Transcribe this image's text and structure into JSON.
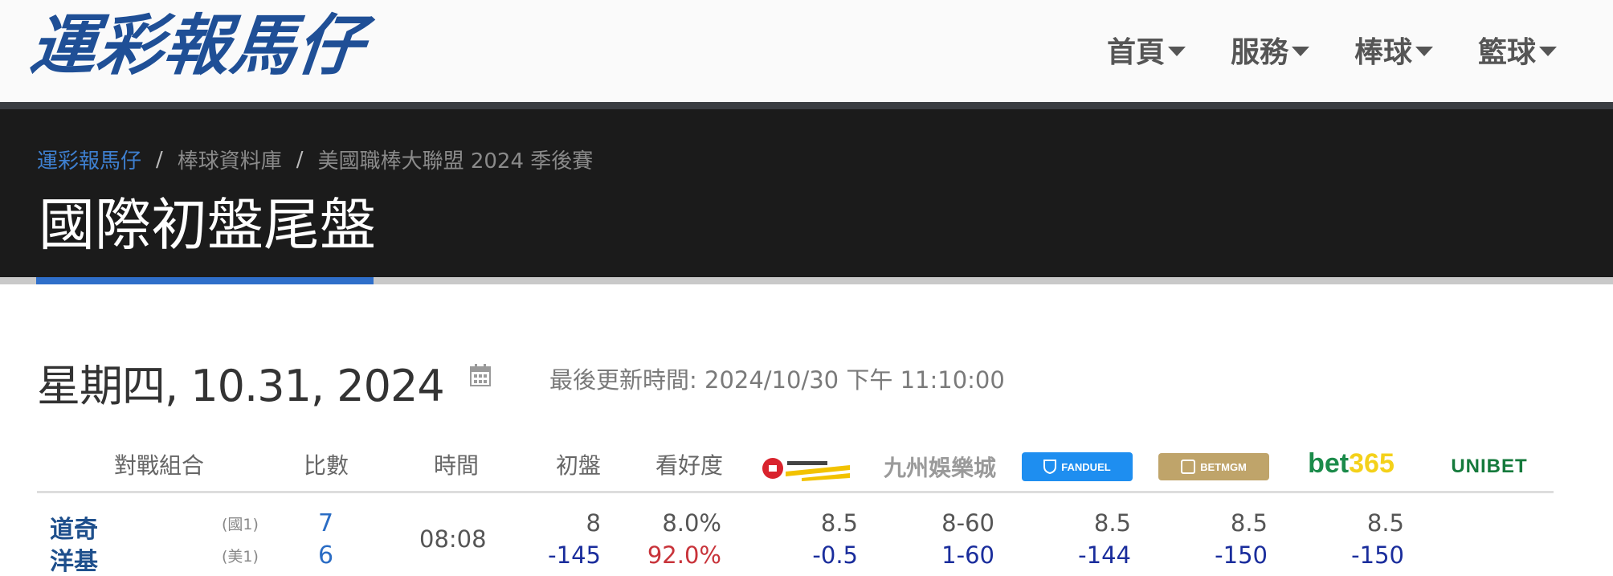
{
  "header": {
    "logo_text": "運彩報馬仔",
    "nav": [
      {
        "label": "首頁"
      },
      {
        "label": "服務"
      },
      {
        "label": "棒球"
      },
      {
        "label": "籃球"
      }
    ]
  },
  "breadcrumb": {
    "items": [
      "運彩報馬仔",
      "棒球資料庫",
      "美國職棒大聯盟 2024 季後賽"
    ],
    "separator": "/"
  },
  "page_title": "國際初盤尾盤",
  "date_section": {
    "date": "星期四, 10.31, 2024",
    "calendar_icon": "calendar-icon",
    "last_updated": "最後更新時間: 2024/10/30 下午 11:10:00"
  },
  "table": {
    "headers": [
      "對戰組合",
      "比數",
      "時間",
      "初盤",
      "看好度"
    ],
    "bookmakers": [
      {
        "name": "台灣運彩",
        "color": "#d9232d"
      },
      {
        "name": "九州娛樂城",
        "color": "#9a9a9a"
      },
      {
        "name": "FANDUEL",
        "color": "#1e8ef0"
      },
      {
        "name": "BETMGM",
        "color": "#bfa46a"
      },
      {
        "name": "bet365",
        "color": "#1b8b4a"
      },
      {
        "name": "UNIBET",
        "color": "#157a3c"
      }
    ],
    "rows": [
      {
        "home_team": "道奇",
        "home_tag": "(國1)",
        "home_score": "7",
        "away_team": "洋基",
        "away_tag": "(美1)",
        "away_score": "6",
        "time": "08:08",
        "open_top": "8",
        "open_bottom": "-145",
        "fav_top": "8.0%",
        "fav_bottom": "92.0%",
        "books": [
          {
            "top": "8.5",
            "bottom": "-0.5"
          },
          {
            "top": "8-60",
            "bottom": "1-60"
          },
          {
            "top": "8.5",
            "bottom": "-144"
          },
          {
            "top": "8.5",
            "bottom": "-150"
          },
          {
            "top": "8.5",
            "bottom": "-150"
          },
          {
            "top": "",
            "bottom": ""
          }
        ]
      }
    ]
  },
  "colors": {
    "logo": "#1f4f96",
    "band": "#1b1b1b",
    "accent": "#2f6fca",
    "link": "#3e7fcf",
    "red": "#c8333a",
    "navy": "#1a2d9c"
  }
}
